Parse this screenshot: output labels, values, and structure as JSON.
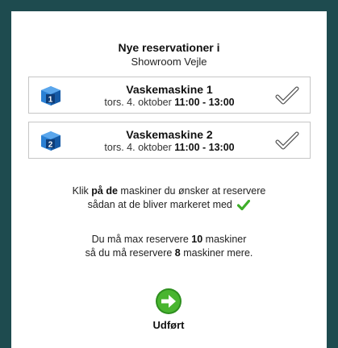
{
  "header": {
    "title": "Nye reservationer i",
    "subtitle": "Showroom Vejle"
  },
  "machines": [
    {
      "number": "1",
      "name": "Vaskemaskine 1",
      "date": "tors. 4. oktober",
      "time": "11:00 - 13:00"
    },
    {
      "number": "2",
      "name": "Vaskemaskine 2",
      "date": "tors. 4. oktober",
      "time": "11:00 - 13:00"
    }
  ],
  "instructions": {
    "line1_a": "Klik",
    "line1_b": "på de",
    "line1_c": "maskiner du ønsker at reservere",
    "line2": "sådan at de bliver markeret med"
  },
  "limits": {
    "line1_pre": "Du må max reservere",
    "max_count": "10",
    "line1_post": "maskiner",
    "line2_pre": "så du må reservere",
    "remaining_count": "8",
    "line2_post": "maskiner mere."
  },
  "done_button": {
    "label": "Udført"
  },
  "colors": {
    "background": "#1e4b4f",
    "icon_blue": "#1f6fc6",
    "check_green": "#3fae2a",
    "done_green": "#3fae2a"
  }
}
